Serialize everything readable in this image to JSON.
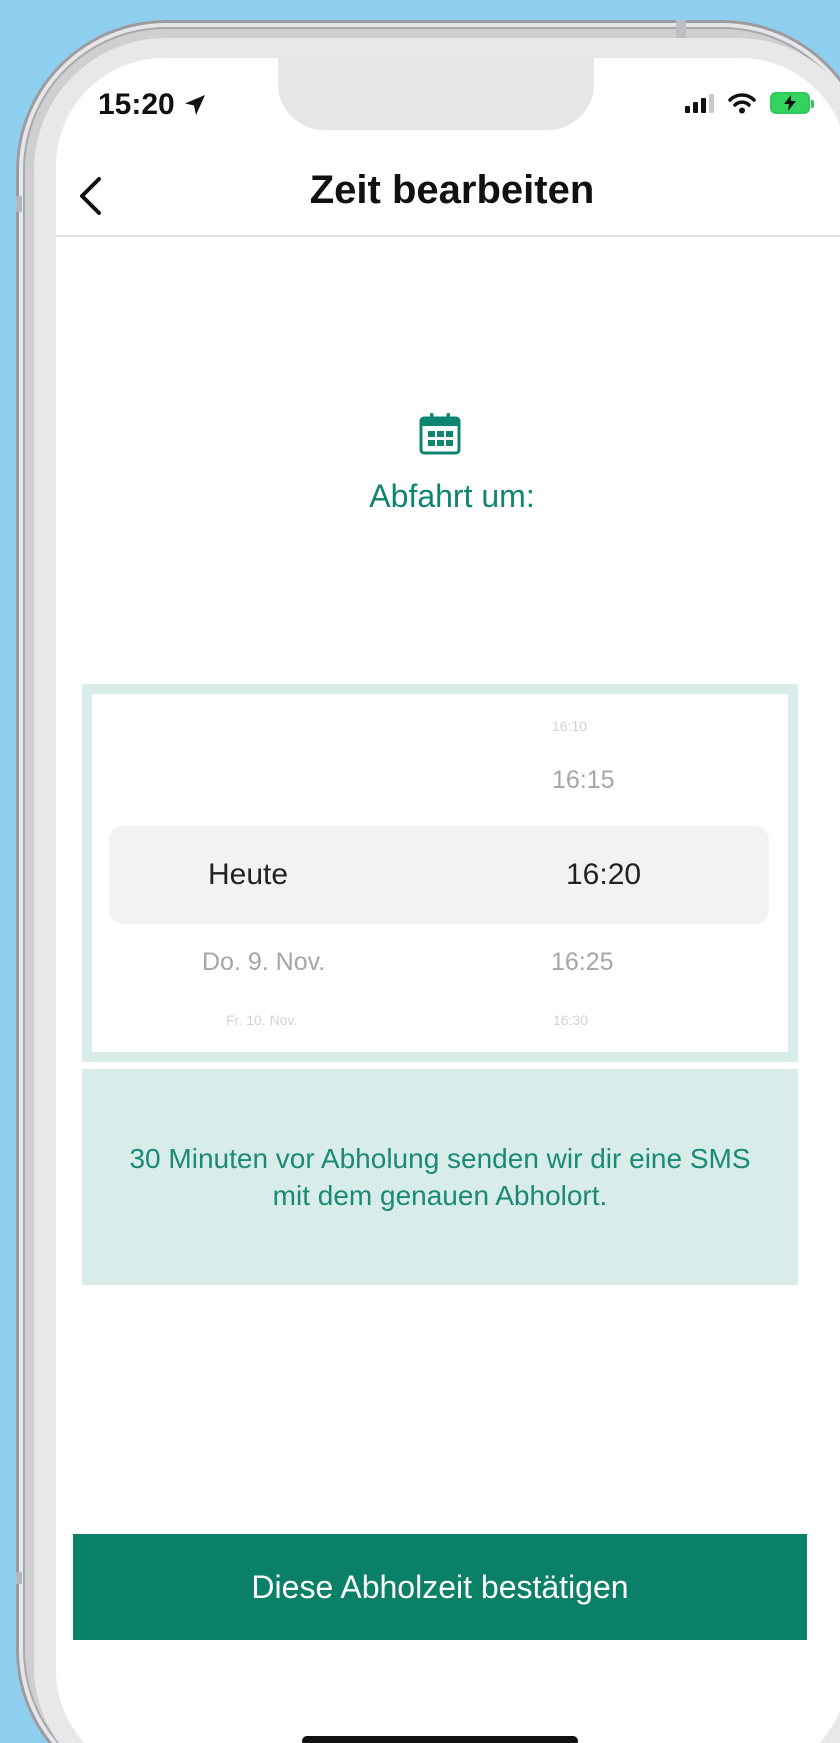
{
  "status_bar": {
    "time": "15:20",
    "icons": [
      "location-arrow-icon",
      "cellular-signal-icon",
      "wifi-icon",
      "battery-charging-icon"
    ]
  },
  "nav": {
    "back_icon": "chevron-left-icon",
    "title": "Zeit bearbeiten"
  },
  "header": {
    "icon": "calendar-icon",
    "label": "Abfahrt um:"
  },
  "picker": {
    "days": {
      "selected": "Heute",
      "below": [
        "Do. 9. Nov.",
        "Fr. 10. Nov."
      ]
    },
    "times": {
      "above": [
        "16:10",
        "16:15"
      ],
      "selected": "16:20",
      "below": [
        "16:25",
        "16:30"
      ]
    }
  },
  "info": {
    "message": "30 Minuten vor Abholung senden wir dir eine SMS mit dem genauen Abholort."
  },
  "actions": {
    "confirm_label": "Diese Abholzeit bestätigen"
  },
  "colors": {
    "accent": "#0b8068",
    "accent_text": "#0d8570",
    "info_bg": "#d8edea",
    "background": "#8ecff0"
  }
}
